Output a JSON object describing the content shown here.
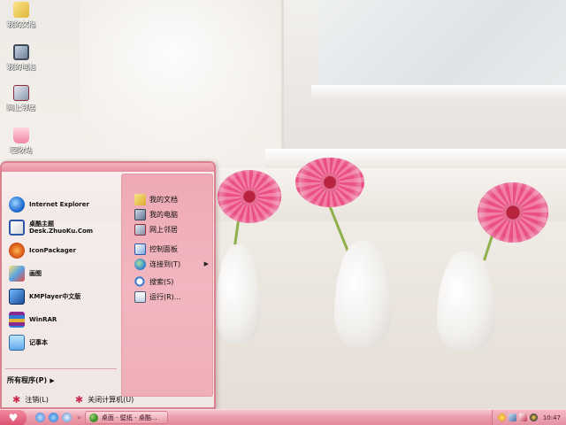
{
  "desktop": {
    "icons": [
      {
        "label": "我的文档",
        "icon": "my-documents-icon"
      },
      {
        "label": "我的电脑",
        "icon": "my-computer-icon"
      },
      {
        "label": "网上邻居",
        "icon": "network-places-icon"
      },
      {
        "label": "回收站",
        "icon": "recycle-bin-icon"
      }
    ]
  },
  "start_menu": {
    "programs": [
      {
        "label": "Internet Explorer",
        "icon": "internet-explorer-icon"
      },
      {
        "label": "桌酷主题",
        "sublabel": "Desk.ZhuoKu.Com",
        "icon": "zhuoku-theme-icon"
      },
      {
        "label": "IconPackager",
        "icon": "iconpackager-icon"
      },
      {
        "label": "画图",
        "icon": "paint-icon"
      },
      {
        "label": "KMPlayer中文版",
        "icon": "kmplayer-icon"
      },
      {
        "label": "WinRAR",
        "icon": "winrar-icon"
      },
      {
        "label": "记事本",
        "icon": "notepad-icon"
      }
    ],
    "all_programs": "所有程序(P)",
    "places": [
      {
        "label": "我的文档",
        "icon": "my-documents-icon"
      },
      {
        "label": "我的电脑",
        "icon": "my-computer-icon"
      },
      {
        "label": "网上邻居",
        "icon": "network-places-icon"
      },
      {
        "label": "控制面板",
        "icon": "control-panel-icon"
      },
      {
        "label": "连接到(T)",
        "icon": "connect-to-icon",
        "submenu": true
      },
      {
        "label": "搜索(S)",
        "icon": "search-icon"
      },
      {
        "label": "运行(R)...",
        "icon": "run-icon"
      }
    ],
    "logoff": "注销(L)",
    "shutdown": "关闭计算机(U)"
  },
  "taskbar": {
    "task_label": "桌面 - 壁纸 - 桌酷...",
    "clock": "10:47"
  },
  "colors": {
    "accent": "#e88f9f",
    "menu_right_pane": "#f1b6bf",
    "taskbar": "#ec9fae"
  }
}
